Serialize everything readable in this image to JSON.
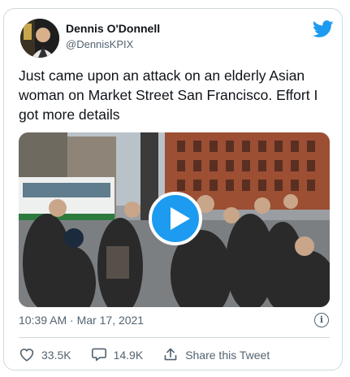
{
  "author": {
    "name": "Dennis O'Donnell",
    "handle": "@DennisKPIX"
  },
  "tweet": {
    "text": "Just came upon an attack on an elderly Asian woman on Market Street San Francisco. Effort I got more details",
    "timestamp": "10:39 AM · Mar 17, 2021"
  },
  "actions": {
    "likes": "33.5K",
    "replies": "14.9K",
    "share_label": "Share this Tweet"
  },
  "icons": {
    "brand": "twitter-bird-icon",
    "play": "play-icon",
    "info": "info-icon",
    "like": "heart-icon",
    "reply": "comment-icon",
    "share": "share-icon"
  },
  "colors": {
    "accent": "#1d9bf0",
    "text": "#0f1419",
    "muted": "#536471",
    "border": "#cfd9de"
  }
}
